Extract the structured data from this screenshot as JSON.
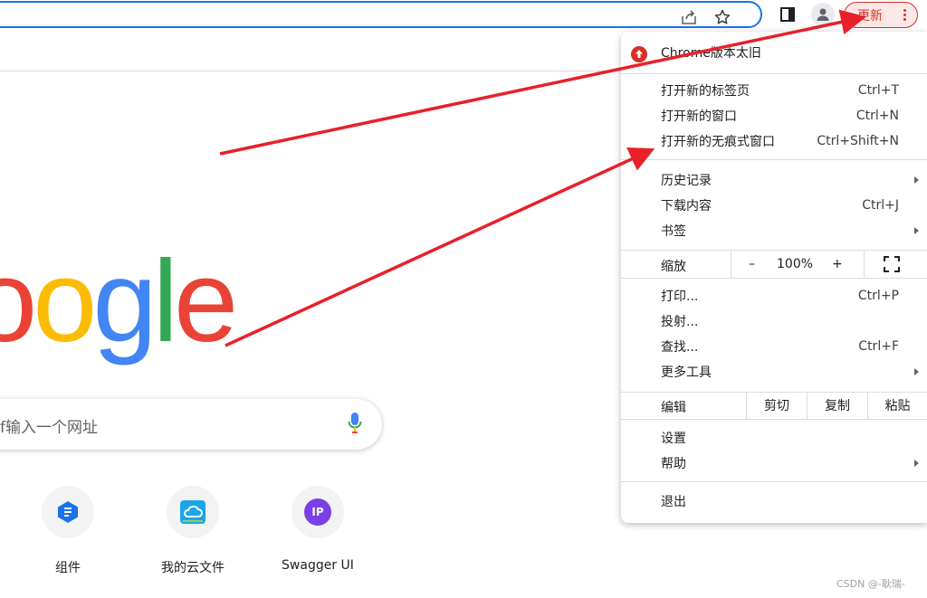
{
  "toolbar": {
    "update_label": "更新",
    "icons": [
      "share-icon",
      "star-icon",
      "side-panel-icon",
      "profile-icon",
      "kebab-menu-icon"
    ]
  },
  "new_tab_page": {
    "logo_letters": [
      "o",
      "o",
      "g",
      "l",
      "e"
    ],
    "logo_colors": [
      "#EA4335",
      "#FBBC05",
      "#4285F4",
      "#34A853",
      "#EA4335"
    ],
    "search_placeholder": "f输入一个网址",
    "shortcuts": [
      {
        "label": "组件",
        "icon": "component-icon",
        "color": "#1a73e8"
      },
      {
        "label": "我的云文件",
        "icon": "cloud-file-icon",
        "color": "#1aa6e8"
      },
      {
        "label": "Swagger UI",
        "icon": "swagger-ip-icon",
        "color": "#7b3fe4",
        "icon_text": "IP"
      }
    ]
  },
  "menu": {
    "update_item": "Chrome版本太旧",
    "items": [
      {
        "label": "打开新的标签页",
        "shortcut": "Ctrl+T"
      },
      {
        "label": "打开新的窗口",
        "shortcut": "Ctrl+N"
      },
      {
        "label": "打开新的无痕式窗口",
        "shortcut": "Ctrl+Shift+N"
      },
      {
        "label": "历史记录",
        "shortcut": ""
      },
      {
        "label": "下载内容",
        "shortcut": "Ctrl+J"
      },
      {
        "label": "书签",
        "shortcut": ""
      },
      {
        "label": "打印...",
        "shortcut": "Ctrl+P"
      },
      {
        "label": "投射...",
        "shortcut": ""
      },
      {
        "label": "查找...",
        "shortcut": "Ctrl+F"
      },
      {
        "label": "更多工具",
        "shortcut": ""
      },
      {
        "label": "设置",
        "shortcut": ""
      },
      {
        "label": "帮助",
        "shortcut": ""
      },
      {
        "label": "退出",
        "shortcut": ""
      }
    ],
    "zoom": {
      "label": "缩放",
      "minus": "–",
      "value": "100%",
      "plus": "+"
    },
    "edit": {
      "label": "编辑",
      "cut": "剪切",
      "copy": "复制",
      "paste": "粘贴"
    }
  },
  "annotation_color": "#e8202a",
  "watermark": "CSDN @-耿瑞-"
}
